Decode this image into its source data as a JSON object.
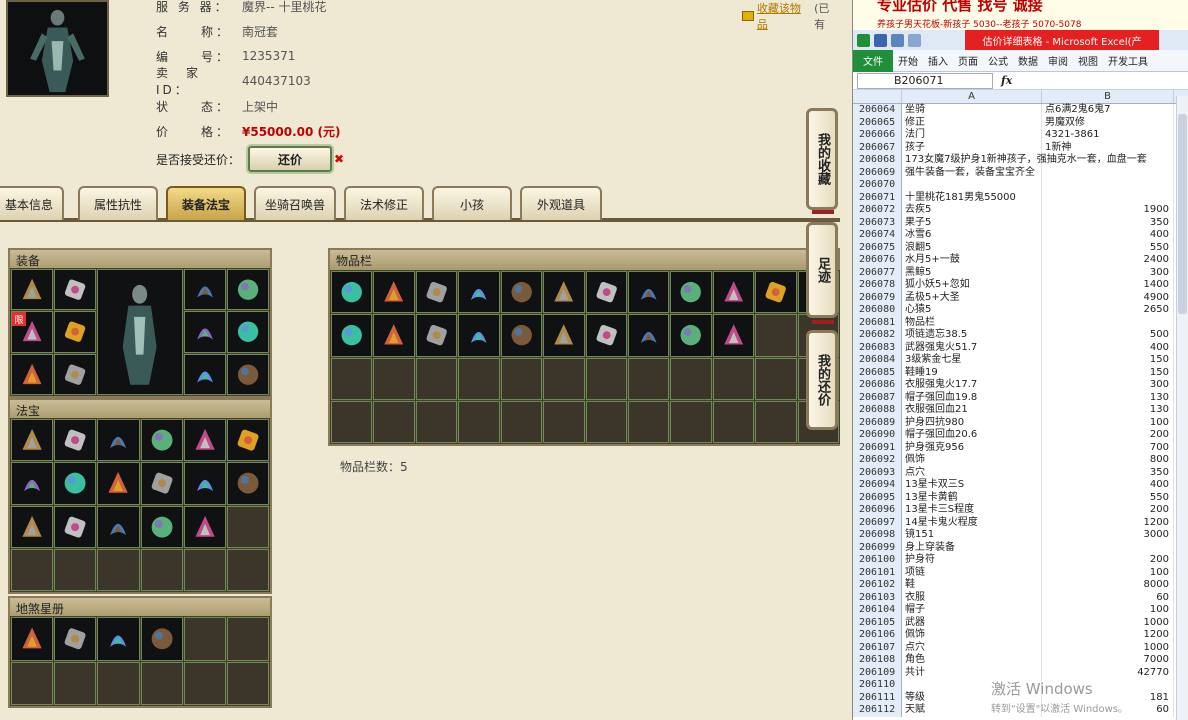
{
  "header": {
    "server_label": "服 务 器：",
    "server_value": "魔界-- 十里桃花",
    "name_label": "名　　称：",
    "name_value": "南冠套",
    "id_label": "编　　号：",
    "id_value": "1235371",
    "seller_label": "卖　家　ID：",
    "seller_value": "440437103",
    "status_label": "状　　态：",
    "status_value": "上架中",
    "price_label": "价　　格：",
    "price_value": "¥55000.00 (元)",
    "offer_label": "是否接受还价：",
    "offer_button": "还价",
    "offer_close": "✖",
    "favorite_link": "收藏该物品",
    "favorite_tail": "(已有"
  },
  "tabs": [
    "基本信息",
    "属性抗性",
    "装备法宝",
    "坐骑召唤兽",
    "法术修正",
    "小孩",
    "外观道具"
  ],
  "active_tab": 2,
  "panels": {
    "equipment": "装备",
    "treasure": "法宝",
    "star_book": "地煞星册",
    "inventory": "物品栏",
    "inventory_count": "物品栏数：5",
    "limit_badge": "限"
  },
  "side_buttons": [
    "我的收藏",
    "足迹",
    "我的还价"
  ],
  "excel": {
    "banner_main": "专业估价 代售 找号 诚接",
    "banner_sub": "养孩子男天花板-新孩子 5030--老孩子 5070-5078",
    "window_title": "估价详细表格 - Microsoft Excel(产",
    "ribbon_file": "文件",
    "ribbon_tabs": [
      "开始",
      "插入",
      "页面",
      "公式",
      "数据",
      "审阅",
      "视图",
      "开发工具"
    ],
    "name_box": "B206071",
    "fx": "fx",
    "col_a": "A",
    "col_b": "B",
    "rows": [
      {
        "n": "206064",
        "a": "坐骑",
        "b": "点6满2鬼6鬼7",
        "t": true
      },
      {
        "n": "206065",
        "a": "修正",
        "b": "男魔双修",
        "t": true
      },
      {
        "n": "206066",
        "a": "法门",
        "b": "4321-3861",
        "t": true
      },
      {
        "n": "206067",
        "a": "孩子",
        "b": "1新神",
        "t": true
      },
      {
        "n": "206068",
        "a": "173女魔7级护身1新神孩子，强抽克水一套，血盘一套",
        "b": "",
        "t": true
      },
      {
        "n": "206069",
        "a": "强牛装备一套，装备宝宝齐全",
        "b": "",
        "t": true
      },
      {
        "n": "206070",
        "a": "",
        "b": "",
        "t": true
      },
      {
        "n": "206071",
        "a": "十里桃花181男鬼55000",
        "b": "",
        "t": true
      },
      {
        "n": "206072",
        "a": "去疾5",
        "b": "1900",
        "t": false
      },
      {
        "n": "206073",
        "a": "果子5",
        "b": "350",
        "t": false
      },
      {
        "n": "206074",
        "a": "冰雪6",
        "b": "400",
        "t": false
      },
      {
        "n": "206075",
        "a": "浪翻5",
        "b": "550",
        "t": false
      },
      {
        "n": "206076",
        "a": "水月5+一鼓",
        "b": "2400",
        "t": false
      },
      {
        "n": "206077",
        "a": "黑鲸5",
        "b": "300",
        "t": false
      },
      {
        "n": "206078",
        "a": "狐小妖5+忽如",
        "b": "1400",
        "t": false
      },
      {
        "n": "206079",
        "a": "孟极5+大圣",
        "b": "4900",
        "t": false
      },
      {
        "n": "206080",
        "a": "心猿5",
        "b": "2650",
        "t": false
      },
      {
        "n": "206081",
        "a": "物品栏",
        "b": "",
        "t": true
      },
      {
        "n": "206082",
        "a": "项链遗忘38.5",
        "b": "500",
        "t": false
      },
      {
        "n": "206083",
        "a": "武器强鬼火51.7",
        "b": "400",
        "t": false
      },
      {
        "n": "206084",
        "a": "3级紫金七星",
        "b": "150",
        "t": false
      },
      {
        "n": "206085",
        "a": "鞋睡19",
        "b": "150",
        "t": false
      },
      {
        "n": "206086",
        "a": "衣服强鬼火17.7",
        "b": "300",
        "t": false
      },
      {
        "n": "206087",
        "a": "帽子强回血19.8",
        "b": "130",
        "t": false
      },
      {
        "n": "206088",
        "a": "衣服强回血21",
        "b": "130",
        "t": false
      },
      {
        "n": "206089",
        "a": "护身四抗980",
        "b": "100",
        "t": false
      },
      {
        "n": "206090",
        "a": "帽子强回血20.6",
        "b": "200",
        "t": false
      },
      {
        "n": "206091",
        "a": "护身强克956",
        "b": "700",
        "t": false
      },
      {
        "n": "206092",
        "a": "佩饰",
        "b": "800",
        "t": false
      },
      {
        "n": "206093",
        "a": "点穴",
        "b": "350",
        "t": false
      },
      {
        "n": "206094",
        "a": "13星卡双三S",
        "b": "400",
        "t": false
      },
      {
        "n": "206095",
        "a": "13星卡黄鹤",
        "b": "550",
        "t": false
      },
      {
        "n": "206096",
        "a": "13星卡三S程度",
        "b": "200",
        "t": false
      },
      {
        "n": "206097",
        "a": "14星卡鬼火程度",
        "b": "1200",
        "t": false
      },
      {
        "n": "206098",
        "a": "镜151",
        "b": "3000",
        "t": false
      },
      {
        "n": "206099",
        "a": "身上穿装备",
        "b": "",
        "t": true
      },
      {
        "n": "206100",
        "a": "护身符",
        "b": "200",
        "t": false
      },
      {
        "n": "206101",
        "a": "项链",
        "b": "100",
        "t": false
      },
      {
        "n": "206102",
        "a": "鞋",
        "b": "8000",
        "t": false
      },
      {
        "n": "206103",
        "a": "衣服",
        "b": "60",
        "t": false
      },
      {
        "n": "206104",
        "a": "帽子",
        "b": "100",
        "t": false
      },
      {
        "n": "206105",
        "a": "武器",
        "b": "1000",
        "t": false
      },
      {
        "n": "206106",
        "a": "佩饰",
        "b": "1200",
        "t": false
      },
      {
        "n": "206107",
        "a": "点穴",
        "b": "1000",
        "t": false
      },
      {
        "n": "206108",
        "a": "角色",
        "b": "7000",
        "t": false
      },
      {
        "n": "206109",
        "a": "共计",
        "b": "42770",
        "t": false
      },
      {
        "n": "206110",
        "a": "",
        "b": "",
        "t": true
      },
      {
        "n": "206111",
        "a": "等级",
        "b": "181",
        "t": false
      },
      {
        "n": "206112",
        "a": "天赋",
        "b": "60",
        "t": false
      }
    ],
    "watermark": "激活 Windows",
    "watermark_sub": "转到\"设置\"以激活 Windows。"
  },
  "colors": {
    "accent_red": "#c00000",
    "excel_green": "#1f8f3a",
    "tab_active": "#c8a44a"
  }
}
